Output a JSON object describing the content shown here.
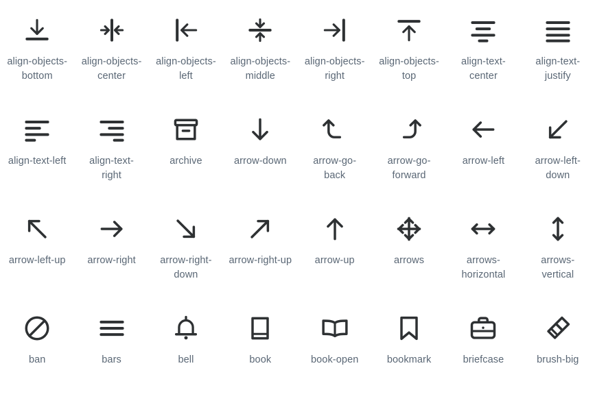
{
  "page": {
    "title": "Icon Gallery",
    "background_color": "#ffffff",
    "icon_color": "#2e3133",
    "label_color": "#5a6775",
    "columns": 8,
    "rows": 4,
    "icon_count": 32
  },
  "icons": [
    {
      "name": "align-objects-bottom",
      "label": "align-objects-bottom",
      "icon": "align-objects-bottom-icon"
    },
    {
      "name": "align-objects-center",
      "label": "align-objects-center",
      "icon": "align-objects-center-icon"
    },
    {
      "name": "align-objects-left",
      "label": "align-objects-left",
      "icon": "align-objects-left-icon"
    },
    {
      "name": "align-objects-middle",
      "label": "align-objects-middle",
      "icon": "align-objects-middle-icon"
    },
    {
      "name": "align-objects-right",
      "label": "align-objects-right",
      "icon": "align-objects-right-icon"
    },
    {
      "name": "align-objects-top",
      "label": "align-objects-top",
      "icon": "align-objects-top-icon"
    },
    {
      "name": "align-text-center",
      "label": "align-text-center",
      "icon": "align-text-center-icon"
    },
    {
      "name": "align-text-justify",
      "label": "align-text-justify",
      "icon": "align-text-justify-icon"
    },
    {
      "name": "align-text-left",
      "label": "align-text-left",
      "icon": "align-text-left-icon"
    },
    {
      "name": "align-text-right",
      "label": "align-text-right",
      "icon": "align-text-right-icon"
    },
    {
      "name": "archive",
      "label": "archive",
      "icon": "archive-icon"
    },
    {
      "name": "arrow-down",
      "label": "arrow-down",
      "icon": "arrow-down-icon"
    },
    {
      "name": "arrow-go-back",
      "label": "arrow-go-back",
      "icon": "arrow-go-back-icon"
    },
    {
      "name": "arrow-go-forward",
      "label": "arrow-go-forward",
      "icon": "arrow-go-forward-icon"
    },
    {
      "name": "arrow-left",
      "label": "arrow-left",
      "icon": "arrow-left-icon"
    },
    {
      "name": "arrow-left-down",
      "label": "arrow-left-down",
      "icon": "arrow-left-down-icon"
    },
    {
      "name": "arrow-left-up",
      "label": "arrow-left-up",
      "icon": "arrow-left-up-icon"
    },
    {
      "name": "arrow-right",
      "label": "arrow-right",
      "icon": "arrow-right-icon"
    },
    {
      "name": "arrow-right-down",
      "label": "arrow-right-down",
      "icon": "arrow-right-down-icon"
    },
    {
      "name": "arrow-right-up",
      "label": "arrow-right-up",
      "icon": "arrow-right-up-icon"
    },
    {
      "name": "arrow-up",
      "label": "arrow-up",
      "icon": "arrow-up-icon"
    },
    {
      "name": "arrows",
      "label": "arrows",
      "icon": "arrows-icon"
    },
    {
      "name": "arrows-horizontal",
      "label": "arrows-horizontal",
      "icon": "arrows-horizontal-icon"
    },
    {
      "name": "arrows-vertical",
      "label": "arrows-vertical",
      "icon": "arrows-vertical-icon"
    },
    {
      "name": "ban",
      "label": "ban",
      "icon": "ban-icon"
    },
    {
      "name": "bars",
      "label": "bars",
      "icon": "bars-icon"
    },
    {
      "name": "bell",
      "label": "bell",
      "icon": "bell-icon"
    },
    {
      "name": "book",
      "label": "book",
      "icon": "book-icon"
    },
    {
      "name": "book-open",
      "label": "book-open",
      "icon": "book-open-icon"
    },
    {
      "name": "bookmark",
      "label": "bookmark",
      "icon": "bookmark-icon"
    },
    {
      "name": "briefcase",
      "label": "briefcase",
      "icon": "briefcase-icon"
    },
    {
      "name": "brush-big",
      "label": "brush-big",
      "icon": "brush-big-icon"
    }
  ]
}
